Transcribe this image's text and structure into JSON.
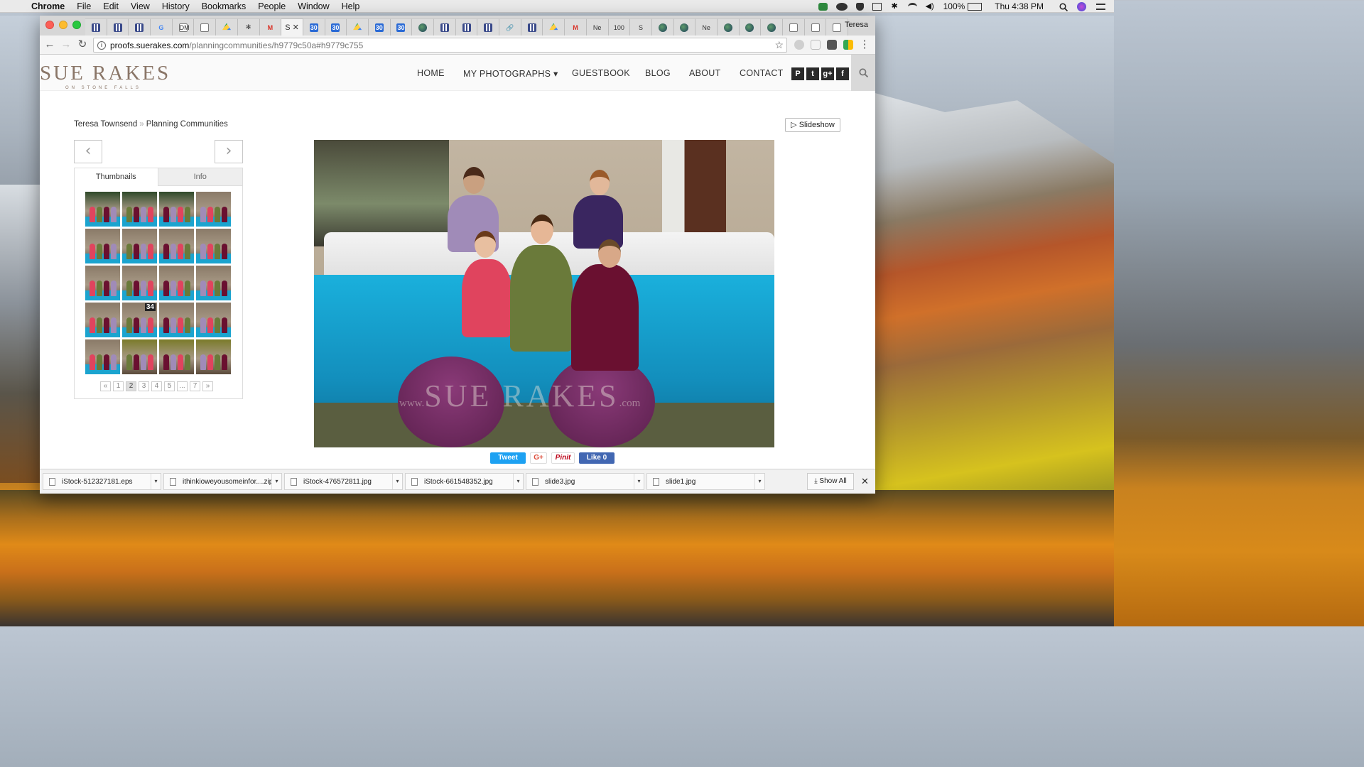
{
  "menubar": {
    "app": "Chrome",
    "items": [
      "File",
      "Edit",
      "View",
      "History",
      "Bookmarks",
      "People",
      "Window",
      "Help"
    ],
    "battery": "100%",
    "clock": "Thu 4:38 PM"
  },
  "browser": {
    "profile": "Teresa",
    "tabs": [
      {
        "icon": "grid"
      },
      {
        "icon": "grid"
      },
      {
        "icon": "grid"
      },
      {
        "icon": "g",
        "text": "G"
      },
      {
        "icon": "doc",
        "text": "DM"
      },
      {
        "icon": "doc"
      },
      {
        "icon": "drive"
      },
      {
        "icon": "asterisk",
        "text": "✻"
      },
      {
        "icon": "gmail",
        "text": "M"
      },
      {
        "icon": "active",
        "text": "S"
      },
      {
        "icon": "cal",
        "text": "30"
      },
      {
        "icon": "cal",
        "text": "30"
      },
      {
        "icon": "drive"
      },
      {
        "icon": "cal",
        "text": "30"
      },
      {
        "icon": "cal",
        "text": "30"
      },
      {
        "icon": "globe"
      },
      {
        "icon": "grid"
      },
      {
        "icon": "grid"
      },
      {
        "icon": "grid"
      },
      {
        "icon": "g",
        "text": "🔗"
      },
      {
        "icon": "grid"
      },
      {
        "icon": "drive"
      },
      {
        "icon": "gmail",
        "text": "M"
      },
      {
        "icon": "text",
        "text": "Ne"
      },
      {
        "icon": "text",
        "text": "100"
      },
      {
        "icon": "text",
        "text": "S"
      },
      {
        "icon": "globe"
      },
      {
        "icon": "globe"
      },
      {
        "icon": "text",
        "text": "Ne"
      },
      {
        "icon": "globe"
      },
      {
        "icon": "globe"
      },
      {
        "icon": "globe"
      },
      {
        "icon": "doc"
      },
      {
        "icon": "doc"
      },
      {
        "icon": "doc"
      }
    ],
    "url_host": "proofs.suerakes.com",
    "url_path": "/planningcommunities/h9779c50a#h9779c755"
  },
  "site": {
    "logo": "SUE RAKES",
    "logo_sub": "ON STONE FALLS",
    "nav": [
      "HOME",
      "MY PHOTOGRAPHS ▾",
      "GUESTBOOK",
      "BLOG",
      "ABOUT",
      "CONTACT"
    ],
    "social": [
      "P",
      "t",
      "g+",
      "f"
    ],
    "breadcrumb": [
      "Teresa Townsend",
      "Planning Communities"
    ],
    "breadcrumb_sep": "»",
    "slideshow": "▷ Slideshow",
    "tab_thumbnails": "Thumbnails",
    "tab_info": "Info",
    "thumb_badge": "34",
    "pager": [
      "«",
      "1",
      "2",
      "3",
      "4",
      "5",
      "...",
      "7",
      "»"
    ],
    "pager_current": "2",
    "watermark_www": "www.",
    "watermark": "SUE RAKES",
    "watermark_com": ".com",
    "share": {
      "tweet": "Tweet",
      "gplus": "G+",
      "pin": "Pinit",
      "like": "Like 0"
    }
  },
  "downloads": {
    "items": [
      "iStock-512327181.eps",
      "ithinkioweyousomeinfor....zip",
      "iStock-476572811.jpg",
      "iStock-661548352.jpg",
      "slide3.jpg",
      "slide1.jpg"
    ],
    "show_all": "Show All"
  }
}
